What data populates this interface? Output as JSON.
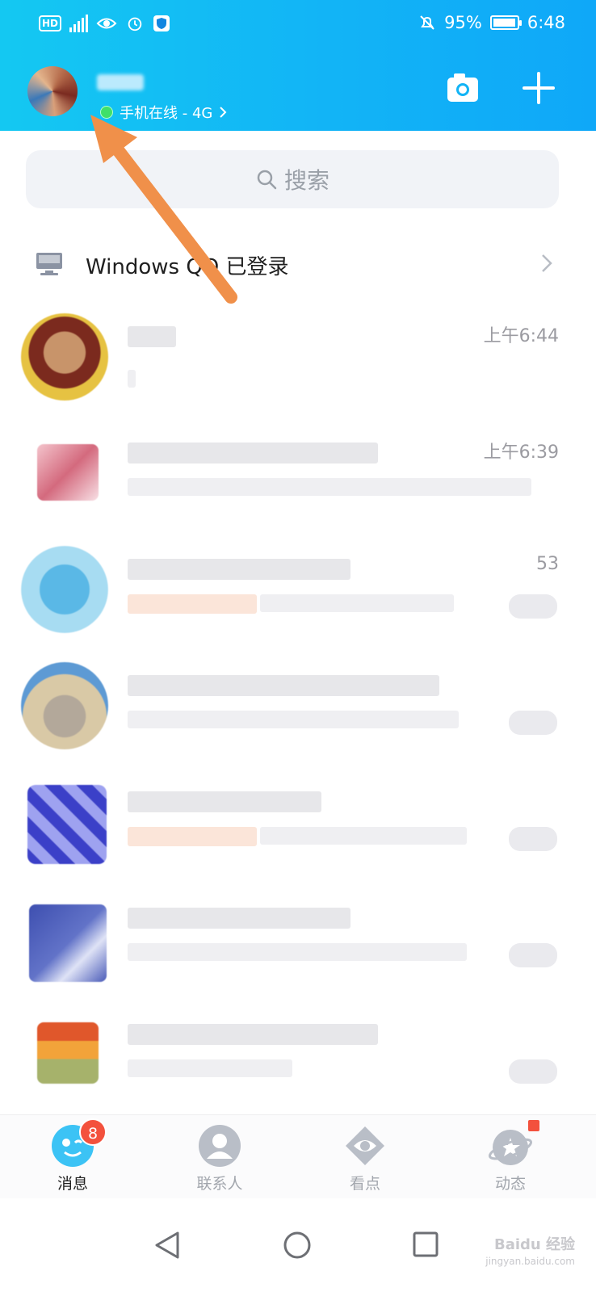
{
  "status_bar": {
    "hd_label": "HD",
    "network_label": "4G",
    "battery_text": "95%",
    "battery_level": 0.95,
    "time": "6:48"
  },
  "header": {
    "online_status": "手机在线 - 4G",
    "camera_icon": "camera-icon",
    "plus_icon": "plus-icon",
    "accent_color": "#12B4F6"
  },
  "search": {
    "placeholder": "搜索"
  },
  "windows_login": {
    "label": "Windows QQ 已登录",
    "icon": "desktop-monitor-icon"
  },
  "chats": [
    {
      "time": "上午6:44"
    },
    {
      "time": "上午6:39"
    },
    {
      "time": "53"
    },
    {
      "time": ""
    },
    {
      "time": ""
    },
    {
      "time": ""
    },
    {
      "time": ""
    }
  ],
  "tabs": [
    {
      "label": "消息",
      "badge": "8",
      "icon": "qq-penguin-icon"
    },
    {
      "label": "联系人",
      "icon": "contact-person-icon"
    },
    {
      "label": "看点",
      "icon": "eye-icon"
    },
    {
      "label": "动态",
      "icon": "star-planet-icon"
    }
  ],
  "nav": {
    "back_icon": "back-triangle-icon",
    "home_icon": "home-circle-icon",
    "recents_icon": "recents-square-icon"
  },
  "watermark": {
    "text": "Baidu 经验",
    "sub": "jingyan.baidu.com"
  }
}
